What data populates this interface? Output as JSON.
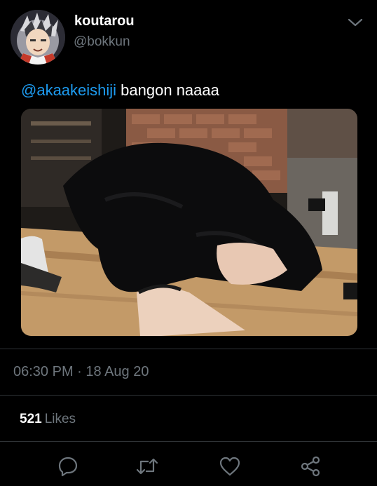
{
  "author": {
    "display_name": "koutarou",
    "handle": "@bokkun"
  },
  "tweet": {
    "mention": "@akaakeishiji",
    "text": " bangon naaaa"
  },
  "meta": {
    "timestamp": "06:30 PM · 18 Aug 20"
  },
  "stats": {
    "likes_count": "521",
    "likes_label": "Likes"
  },
  "icons": {
    "more": "chevron-down-icon",
    "reply": "reply-icon",
    "retweet": "retweet-icon",
    "like": "heart-icon",
    "share": "share-icon"
  },
  "colors": {
    "background": "#000000",
    "mention": "#1d9bf0",
    "secondary_text": "#6e767d",
    "divider": "#2f3336"
  }
}
